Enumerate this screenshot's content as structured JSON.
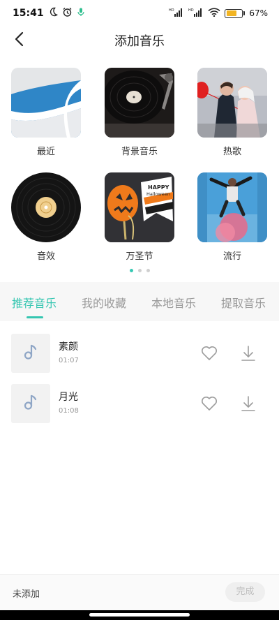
{
  "status_bar": {
    "time": "15:41",
    "battery": "67%",
    "battery_level": 0.67,
    "icons": [
      "moon-icon",
      "alarm-icon",
      "mic-icon",
      "signal-icon",
      "signal-icon",
      "wifi-icon",
      "battery-icon"
    ]
  },
  "header": {
    "title": "添加音乐",
    "back_icon": "back-arrow-icon"
  },
  "categories": [
    {
      "label": "最近"
    },
    {
      "label": "背景音乐"
    },
    {
      "label": "热歌"
    },
    {
      "label": "音效"
    },
    {
      "label": "万圣节",
      "art_text": "HAPPY Halloween"
    },
    {
      "label": "流行"
    }
  ],
  "pagination": {
    "pages": 3,
    "current": 1
  },
  "tabs": [
    {
      "label": "推荐音乐",
      "active": true
    },
    {
      "label": "我的收藏",
      "active": false
    },
    {
      "label": "本地音乐",
      "active": false
    },
    {
      "label": "提取音乐",
      "active": false
    }
  ],
  "songs": [
    {
      "name": "素颜",
      "duration": "01:07",
      "cover_icon": "music-note-icon"
    },
    {
      "name": "月光",
      "duration": "01:08",
      "cover_icon": "music-note-icon"
    }
  ],
  "bottom_bar": {
    "status": "未添加",
    "done_label": "完成"
  },
  "colors": {
    "accent": "#35c6b1",
    "tab_inactive": "#9a9a9a",
    "icon_muted": "#8fa6c6"
  }
}
